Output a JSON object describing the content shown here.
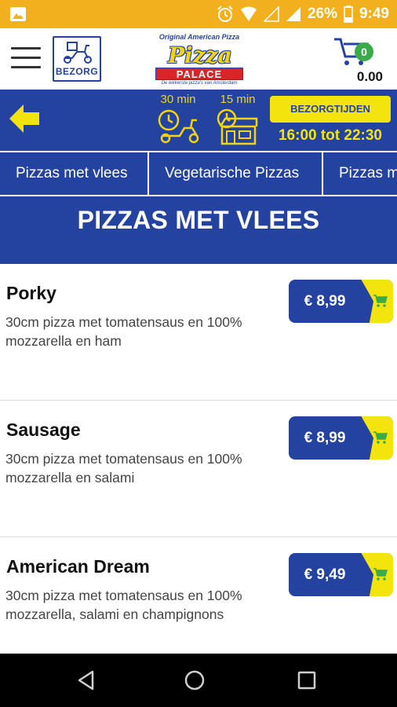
{
  "status_bar": {
    "battery": "26%",
    "time": "9:49"
  },
  "header": {
    "delivery_badge": "BEZORG",
    "logo": {
      "arc_text": "Original American Pizza",
      "script_text": "Pizza",
      "banner_text": "PALACE",
      "tagline": "De lekkerste pizza's van Amsterdam"
    },
    "cart": {
      "count": "0",
      "total": "0.00"
    }
  },
  "info": {
    "delivery_time": "30 min",
    "pickup_time": "15 min",
    "hours_button": "BEZORGTIJDEN",
    "hours": "16:00 tot 22:30"
  },
  "tabs": [
    {
      "label": "Pizzas met vlees"
    },
    {
      "label": "Vegetarische Pizzas"
    },
    {
      "label": "Pizzas m"
    }
  ],
  "section": {
    "title": "PIZZAS MET VLEES"
  },
  "products": [
    {
      "name": "Porky",
      "description": "30cm pizza met tomatensaus en 100% mozzarella en ham",
      "price": "€ 8,99"
    },
    {
      "name": "Sausage",
      "description": "30cm pizza met tomatensaus en 100% mozzarella en salami",
      "price": "€ 8,99"
    },
    {
      "name": "American Dream",
      "description": "30cm pizza met tomatensaus en 100% mozzarella, salami en champignons",
      "price": "€ 9,49"
    }
  ],
  "colors": {
    "status_bar": "#f2b01e",
    "brand_blue": "#2443a0",
    "accent_yellow": "#f4e40e",
    "cart_badge": "#3aaa4a"
  }
}
